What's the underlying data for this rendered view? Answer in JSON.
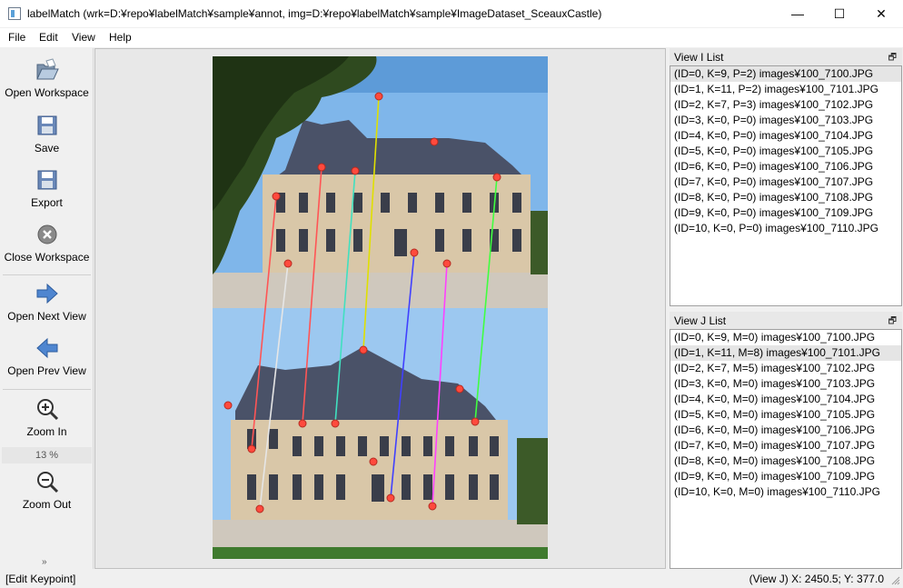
{
  "window": {
    "title": "labelMatch (wrk=D:¥repo¥labelMatch¥sample¥annot, img=D:¥repo¥labelMatch¥sample¥ImageDataset_SceauxCastle)",
    "controls": {
      "minimize": "—",
      "maximize": "☐",
      "close": "✕"
    }
  },
  "menu": [
    "File",
    "Edit",
    "View",
    "Help"
  ],
  "toolbar": {
    "open_workspace": "Open Workspace",
    "save": "Save",
    "export": "Export",
    "close_workspace": "Close Workspace",
    "open_next_view": "Open Next View",
    "open_prev_view": "Open Prev View",
    "zoom_in": "Zoom In",
    "zoom_level": "13 %",
    "zoom_out": "Zoom Out",
    "more": "»"
  },
  "icons": {
    "open": "folder-open-icon",
    "save": "floppy-disk-icon",
    "export": "floppy-disk-icon",
    "close": "circle-close-icon",
    "next": "arrow-right-icon",
    "prev": "arrow-left-icon",
    "zoom_in": "magnifier-plus-icon",
    "zoom_out": "magnifier-minus-icon"
  },
  "view_i": {
    "title": "View I List",
    "float_glyph": "🗗",
    "items": [
      "(ID=0, K=9, P=2) images¥100_7100.JPG",
      "(ID=1, K=11, P=2) images¥100_7101.JPG",
      "(ID=2, K=7, P=3) images¥100_7102.JPG",
      "(ID=3, K=0, P=0) images¥100_7103.JPG",
      "(ID=4, K=0, P=0) images¥100_7104.JPG",
      "(ID=5, K=0, P=0) images¥100_7105.JPG",
      "(ID=6, K=0, P=0) images¥100_7106.JPG",
      "(ID=7, K=0, P=0) images¥100_7107.JPG",
      "(ID=8, K=0, P=0) images¥100_7108.JPG",
      "(ID=9, K=0, P=0) images¥100_7109.JPG",
      "(ID=10, K=0, P=0) images¥100_7110.JPG"
    ],
    "selected": 0
  },
  "view_j": {
    "title": "View J List",
    "float_glyph": "🗗",
    "items": [
      "(ID=0, K=9, M=0) images¥100_7100.JPG",
      "(ID=1, K=11, M=8) images¥100_7101.JPG",
      "(ID=2, K=7, M=5) images¥100_7102.JPG",
      "(ID=3, K=0, M=0) images¥100_7103.JPG",
      "(ID=4, K=0, M=0) images¥100_7104.JPG",
      "(ID=5, K=0, M=0) images¥100_7105.JPG",
      "(ID=6, K=0, M=0) images¥100_7106.JPG",
      "(ID=7, K=0, M=0) images¥100_7107.JPG",
      "(ID=8, K=0, M=0) images¥100_7108.JPG",
      "(ID=9, K=0, M=0) images¥100_7109.JPG",
      "(ID=10, K=0, M=0) images¥100_7110.JPG"
    ],
    "selected": 1
  },
  "status": {
    "mode": "[Edit Keypoint]",
    "coords": "(View J) X: 2450.5; Y: 377.0"
  },
  "colors": {
    "keypoint": "#ff4a3d",
    "sky": "#7fb6ea",
    "roof": "#4a5268",
    "facade": "#d9c7a8",
    "ground": "#cfc8bd",
    "tree": "#2f4a1f",
    "match_lines": [
      "#ff5555",
      "#e0e0e0",
      "#ff5555",
      "#40e0c0",
      "#e0e000",
      "#4040ff",
      "#ff40ff",
      "#40ff40"
    ]
  }
}
